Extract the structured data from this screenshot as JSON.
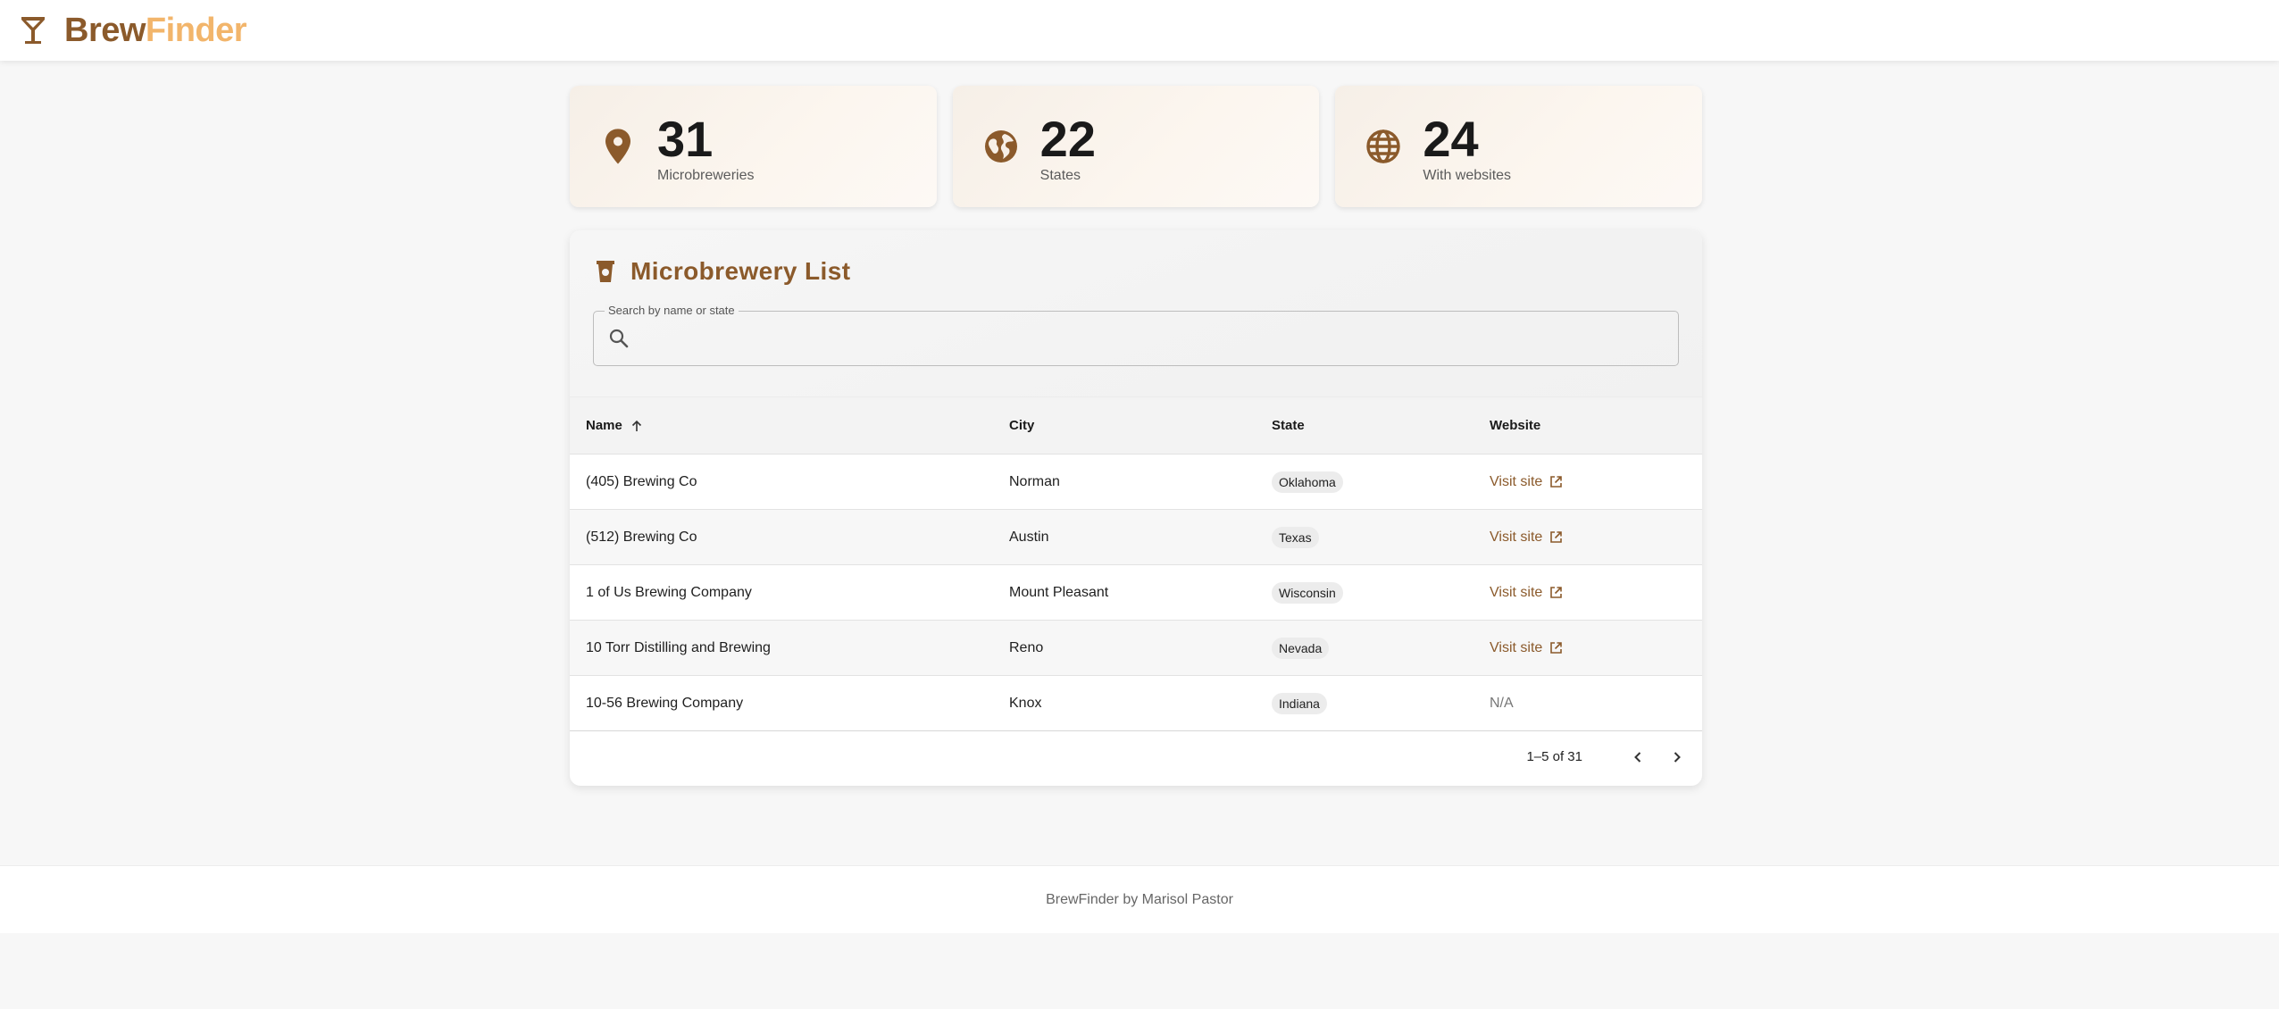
{
  "brand": {
    "part1": "Brew",
    "part2": "Finder",
    "icon": "cocktail-glass-icon",
    "color_primary": "#8b5a2b",
    "color_accent": "#f2b56b"
  },
  "stats": [
    {
      "value": "31",
      "label": "Microbreweries",
      "icon": "location-pin-icon"
    },
    {
      "value": "22",
      "label": "States",
      "icon": "globe-icon"
    },
    {
      "value": "24",
      "label": "With websites",
      "icon": "web-globe-icon"
    }
  ],
  "list": {
    "title": "Microbrewery List",
    "icon": "cup-icon",
    "search": {
      "label": "Search by name or state",
      "value": ""
    },
    "columns": {
      "name": "Name",
      "city": "City",
      "state": "State",
      "website": "Website"
    },
    "rows": [
      {
        "name": "(405) Brewing Co",
        "city": "Norman",
        "state": "Oklahoma",
        "website": "Visit site"
      },
      {
        "name": "(512) Brewing Co",
        "city": "Austin",
        "state": "Texas",
        "website": "Visit site"
      },
      {
        "name": "1 of Us Brewing Company",
        "city": "Mount Pleasant",
        "state": "Wisconsin",
        "website": "Visit site"
      },
      {
        "name": "10 Torr Distilling and Brewing",
        "city": "Reno",
        "state": "Nevada",
        "website": "Visit site"
      },
      {
        "name": "10-56 Brewing Company",
        "city": "Knox",
        "state": "Indiana",
        "website": "N/A"
      }
    ],
    "pagination": "1–5 of 31"
  },
  "footer": {
    "text": "BrewFinder by Marisol Pastor"
  }
}
